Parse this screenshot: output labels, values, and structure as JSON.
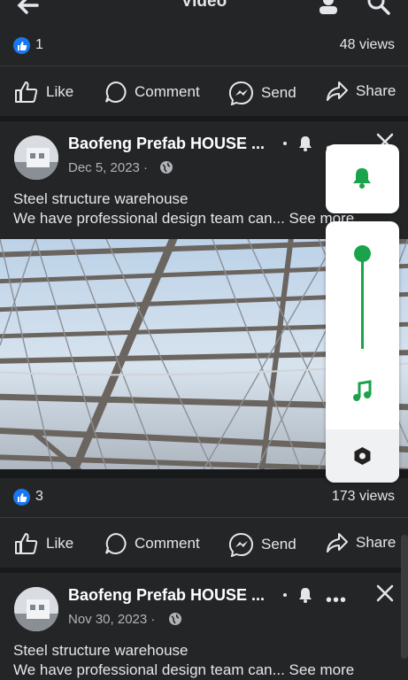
{
  "header": {
    "title": "Video"
  },
  "post1": {
    "likes": "1",
    "views": "48 views"
  },
  "actions": {
    "like": "Like",
    "comment": "Comment",
    "send": "Send",
    "share": "Share"
  },
  "post2": {
    "author": "Baofeng Prefab HOUSE ...",
    "date": "Dec 5, 2023 ·",
    "line1": "Steel structure warehouse",
    "line2": "We have professional design team can...",
    "see_more": "See more",
    "likes": "3",
    "views": "173 views"
  },
  "post3": {
    "author": "Baofeng Prefab HOUSE ...",
    "date": "Nov 30, 2023 ·",
    "line1": "Steel structure warehouse",
    "line2": "We have professional design team can...",
    "see_more": "See more"
  },
  "colors": {
    "accent": "#1877f2",
    "panel_green": "#1aa34a"
  },
  "panel": {
    "slider_level": 1.0
  }
}
